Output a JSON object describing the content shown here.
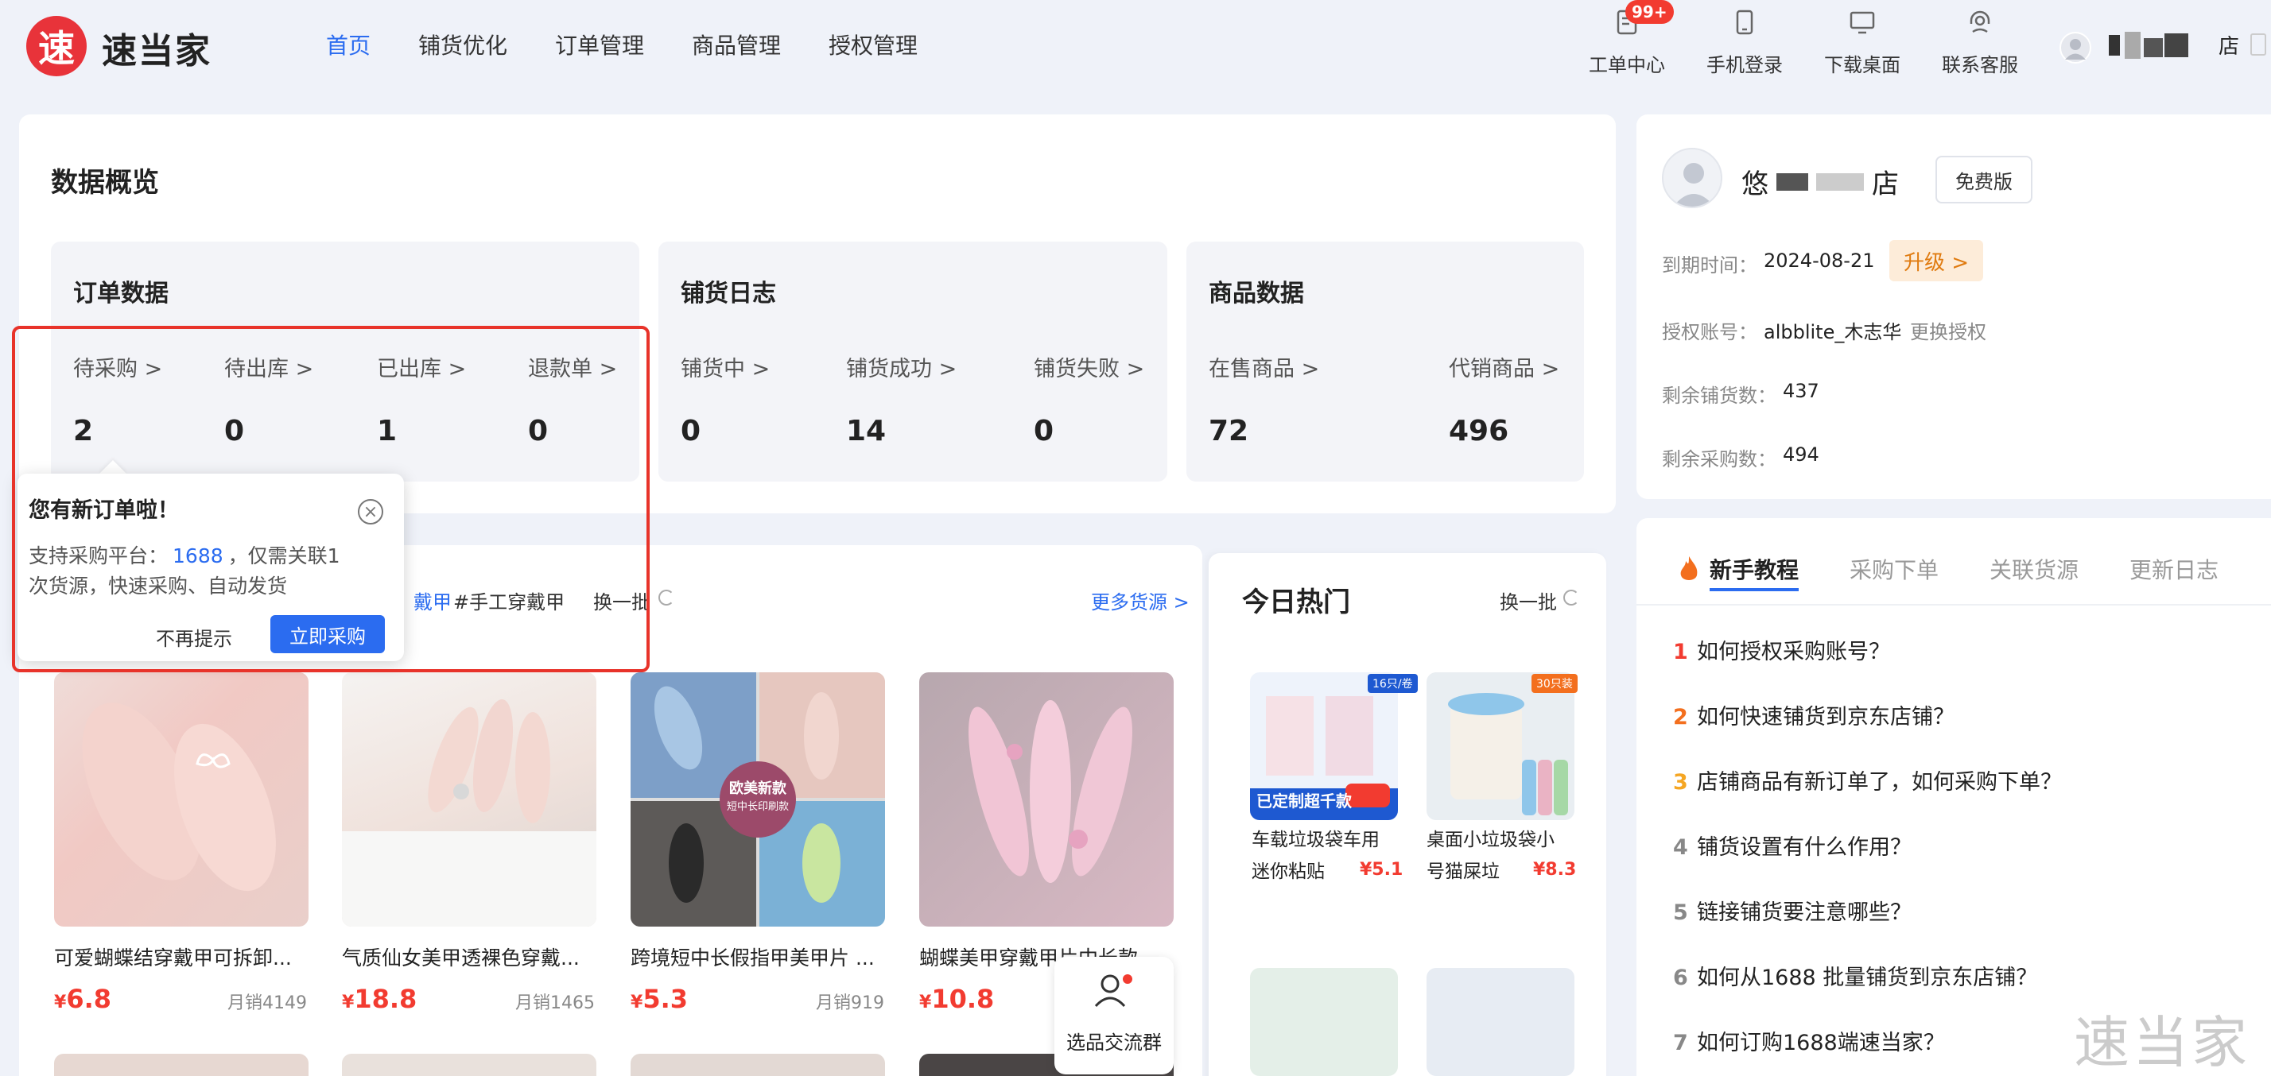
{
  "header": {
    "logo_char": "速",
    "logo_text": "速当家",
    "nav": [
      "首页",
      "铺货优化",
      "订单管理",
      "商品管理",
      "授权管理"
    ],
    "tools": [
      {
        "label": "工单中心",
        "icon": "ticket-icon"
      },
      {
        "label": "手机登录",
        "icon": "phone-icon"
      },
      {
        "label": "下载桌面",
        "icon": "desktop-icon"
      },
      {
        "label": "联系客服",
        "icon": "headset-icon"
      }
    ],
    "ticket_badge": "99+",
    "shop_suffix": "店"
  },
  "overview": {
    "title": "数据概览",
    "order": {
      "title": "订单数据",
      "stats": [
        {
          "label": "待采购 >",
          "value": "2"
        },
        {
          "label": "待出库 >",
          "value": "0"
        },
        {
          "label": "已出库 >",
          "value": "1"
        },
        {
          "label": "退款单 >",
          "value": "0"
        }
      ]
    },
    "distribution": {
      "title": "铺货日志",
      "stats": [
        {
          "label": "铺货中 >",
          "value": "0"
        },
        {
          "label": "铺货成功 >",
          "value": "14"
        },
        {
          "label": "铺货失败 >",
          "value": "0"
        }
      ]
    },
    "product": {
      "title": "商品数据",
      "stats": [
        {
          "label": "在售商品 >",
          "value": "72"
        },
        {
          "label": "代销商品 >",
          "value": "496"
        }
      ]
    }
  },
  "popover": {
    "title": "您有新订单啦！",
    "text_pre": "支持采购平台：",
    "platform": "1688",
    "text_mid": "，仅需关联1",
    "text_line2": "次货源，快速采购、自动发货",
    "dismiss": "不再提示",
    "buy": "立即采购"
  },
  "recommend": {
    "tag_partial": "戴甲",
    "tag2": "#手工穿戴甲",
    "refresh": "换一批",
    "more": "更多货源 >",
    "products": [
      {
        "name": "可爱蝴蝶结穿戴甲可拆卸...",
        "price": "6.8",
        "sales": "月销4149"
      },
      {
        "name": "气质仙女美甲透裸色穿戴...",
        "price": "18.8",
        "sales": "月销1465"
      },
      {
        "name": "跨境短中长假指甲美甲片 ...",
        "price": "5.3",
        "sales": "月销919"
      },
      {
        "name": "蝴蝶美甲穿戴甲片中长款",
        "price": "10.8",
        "sales": ""
      }
    ],
    "image_overlay": [
      "欧美新款",
      "短中长印刷款"
    ],
    "currency": "¥"
  },
  "float_group": {
    "label": "选品交流群"
  },
  "hot": {
    "title": "今日热门",
    "refresh": "换一批",
    "items": [
      {
        "line1": "车载垃圾袋车用",
        "line2": "迷你粘贴",
        "price": "¥5.1",
        "img_tag": "16只/卷",
        "img_banner": "已定制超千款"
      },
      {
        "line1": "桌面小垃圾袋小",
        "line2": "号猫屎垃",
        "price": "¥8.3",
        "img_tag": "30只装"
      }
    ]
  },
  "account": {
    "name_prefix": "悠",
    "name_suffix": "店",
    "plan": "免费版",
    "expire_label": "到期时间：",
    "expire_date": "2024-08-21",
    "upgrade": "升级 >",
    "auth_label": "授权账号：",
    "auth_value": "albblite_木志华",
    "auth_change": "更换授权",
    "remain_dist_label": "剩余铺货数：",
    "remain_dist": "437",
    "remain_buy_label": "剩余采购数：",
    "remain_buy": "494"
  },
  "tutorial": {
    "tabs": [
      "新手教程",
      "采购下单",
      "关联货源",
      "更新日志"
    ],
    "items": [
      {
        "num": "1",
        "text": "如何授权采购账号？",
        "color": "#f23b30"
      },
      {
        "num": "2",
        "text": "如何快速铺货到京东店铺？",
        "color": "#f36f1e"
      },
      {
        "num": "3",
        "text": "店铺商品有新订单了，如何采购下单？",
        "color": "#f5a623"
      },
      {
        "num": "4",
        "text": "铺货设置有什么作用？",
        "color": "#888888"
      },
      {
        "num": "5",
        "text": "链接铺货要注意哪些？",
        "color": "#888888"
      },
      {
        "num": "6",
        "text": "如何从1688 批量铺货到京东店铺？",
        "color": "#888888"
      },
      {
        "num": "7",
        "text": "如何订购1688端速当家？",
        "color": "#888888"
      }
    ]
  },
  "watermark": "速当家",
  "colors": {
    "accent": "#2b6cf0",
    "price": "#f23b30",
    "highlight_box": "#e8332a",
    "upgrade_bg": "#fdecd9",
    "upgrade_text": "#e07b10"
  }
}
